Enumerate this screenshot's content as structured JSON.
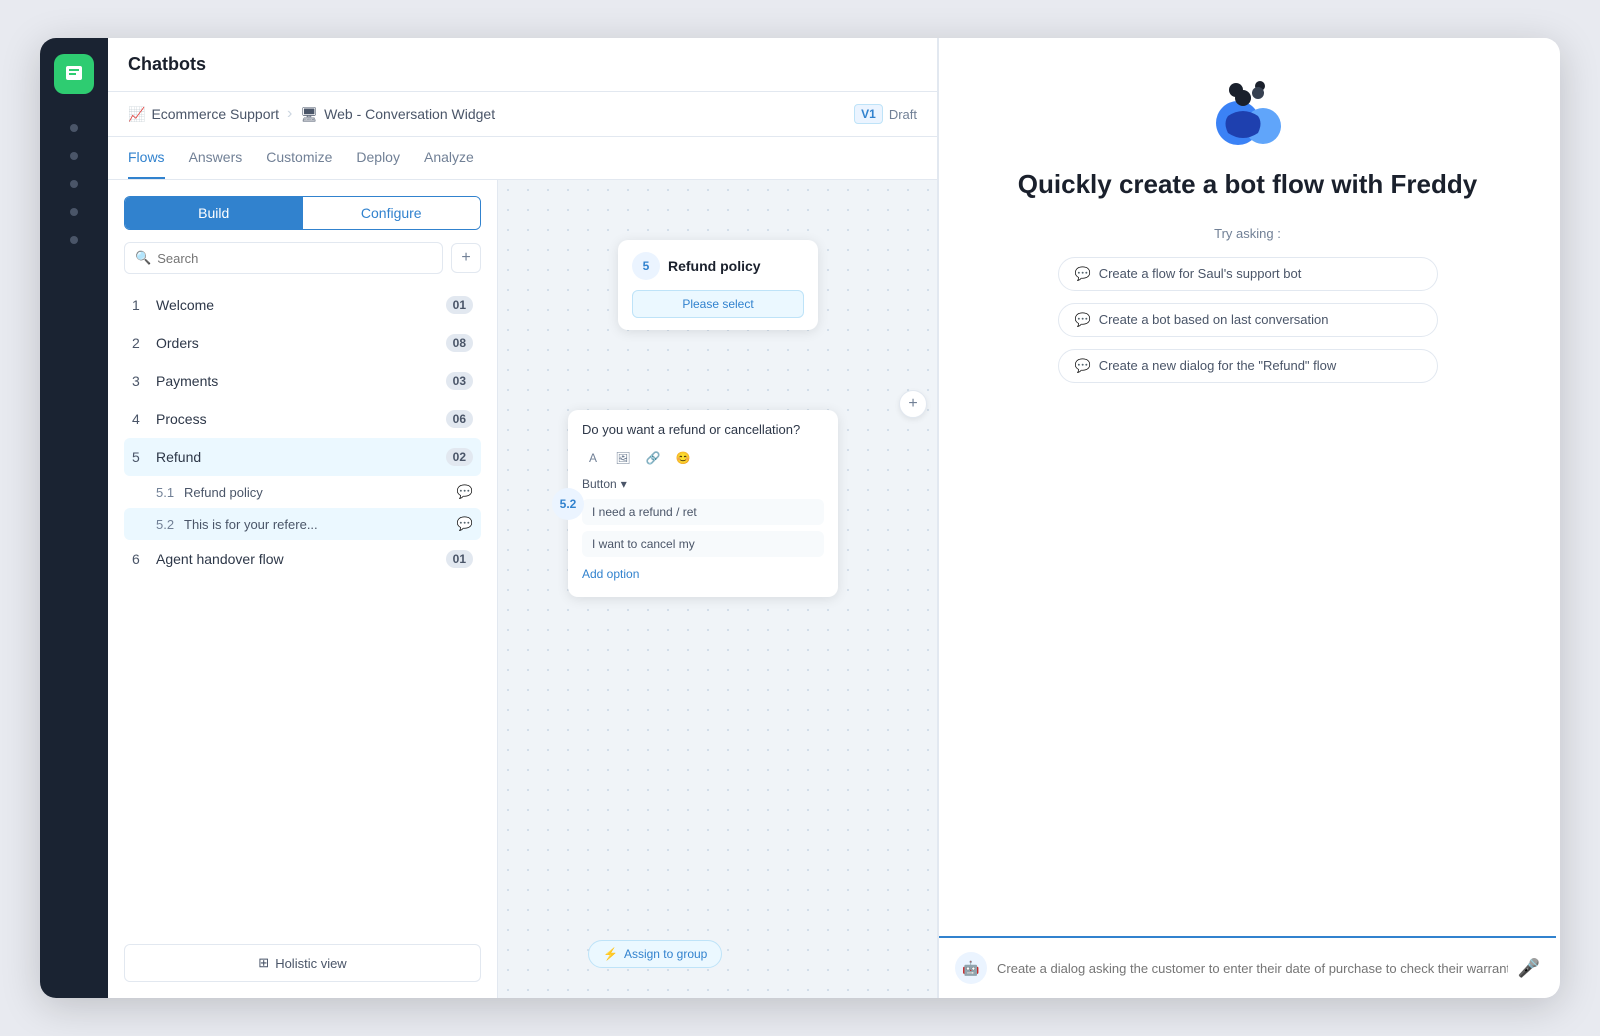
{
  "app": {
    "title": "Chatbots",
    "close_label": "×"
  },
  "breadcrumb": {
    "item1": "Ecommerce Support",
    "item1_icon": "📈",
    "item2": "Web - Conversation Widget",
    "item2_icon": "🖥",
    "version": "V1",
    "status": "Draft"
  },
  "tabs": [
    {
      "label": "Flows",
      "active": true
    },
    {
      "label": "Answers",
      "active": false
    },
    {
      "label": "Customize",
      "active": false
    },
    {
      "label": "Deploy",
      "active": false
    },
    {
      "label": "Analyze",
      "active": false
    }
  ],
  "build_configure": {
    "build": "Build",
    "configure": "Configure"
  },
  "search": {
    "placeholder": "Search"
  },
  "flows": [
    {
      "number": "1",
      "name": "Welcome",
      "count": "01"
    },
    {
      "number": "2",
      "name": "Orders",
      "count": "08"
    },
    {
      "number": "3",
      "name": "Payments",
      "count": "03"
    },
    {
      "number": "4",
      "name": "Process",
      "count": "06"
    },
    {
      "number": "5",
      "name": "Refund",
      "count": "02"
    },
    {
      "number": "6",
      "name": "Agent handover flow",
      "count": "01"
    }
  ],
  "sub_flows": [
    {
      "number": "5.1",
      "name": "Refund policy"
    },
    {
      "number": "5.2",
      "name": "This is for your refere..."
    }
  ],
  "holistic_view": "Holistic view",
  "canvas": {
    "node1_badge": "5",
    "node1_title": "Refund policy",
    "node1_select": "Please select",
    "node2_badge": "5.2",
    "message_text": "Do you want a refund or cancellation?",
    "button_type": "Button",
    "option1": "I need a refund / ret",
    "option2": "I want to cancel my",
    "add_option": "Add option",
    "assign_group": "Assign to group"
  },
  "ai_panel": {
    "title": "Quickly create a bot flow with Freddy",
    "try_asking": "Try asking :",
    "suggestions": [
      "Create a flow for Saul's support bot",
      "Create a bot based on last conversation",
      "Create a new dialog for the \"Refund\" flow"
    ],
    "input_placeholder": "Create a dialog asking the customer to enter their date of purchase to check their warranty eligibility"
  }
}
